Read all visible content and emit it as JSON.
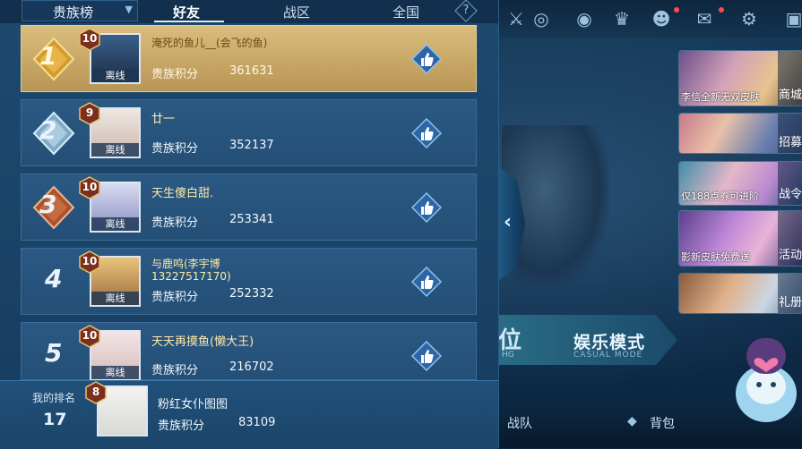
{
  "header": {
    "dropdown_label": "贵族榜",
    "tabs": [
      {
        "label": "好友",
        "active": true
      },
      {
        "label": "战区",
        "active": false
      },
      {
        "label": "全国",
        "active": false
      }
    ],
    "help_symbol": "?"
  },
  "leaderboard": {
    "offline_label": "离线",
    "score_label": "贵族积分",
    "rows": [
      {
        "rank": "1",
        "level": "10",
        "name": "淹死的鱼儿__(会飞的鱼)",
        "name_line2": "",
        "score": "361631"
      },
      {
        "rank": "2",
        "level": "9",
        "name": "廿一",
        "name_line2": "",
        "score": "352137"
      },
      {
        "rank": "3",
        "level": "10",
        "name": "天生傻白甜.",
        "name_line2": "",
        "score": "253341"
      },
      {
        "rank": "4",
        "level": "10",
        "name": "与鹿鸣(李宇博",
        "name_line2": "13227517170)",
        "score": "252332"
      },
      {
        "rank": "5",
        "level": "10",
        "name": "天天再摸鱼(懒大王)",
        "name_line2": "",
        "score": "216702"
      }
    ]
  },
  "my_rank": {
    "label": "我的排名",
    "rank": "17",
    "level": "8",
    "name": "粉红女仆图图",
    "score_label": "贵族积分",
    "score": "83109"
  },
  "right_panel": {
    "promos": [
      {
        "caption": "李信全新无双皮肤",
        "side": "商城"
      },
      {
        "caption": "",
        "side": "招募"
      },
      {
        "caption": "仅188点券可进阶",
        "side": "战令"
      },
      {
        "caption": "影新皮肤免费送",
        "side": "活动"
      },
      {
        "caption": "",
        "side": "礼册"
      }
    ],
    "mode_ranked": "位",
    "mode_ranked_sub": "HG",
    "mode_casual": "娱乐模式",
    "mode_casual_sub": "CASUAL MODE",
    "bottom_team": "战队",
    "bottom_bag": "背包"
  },
  "colors": {
    "panel_bg": "#1e4a70",
    "first_row_gold": "#c8a766",
    "name_gold": "#ffe9a8",
    "like_blue": "#3f8ad0"
  }
}
